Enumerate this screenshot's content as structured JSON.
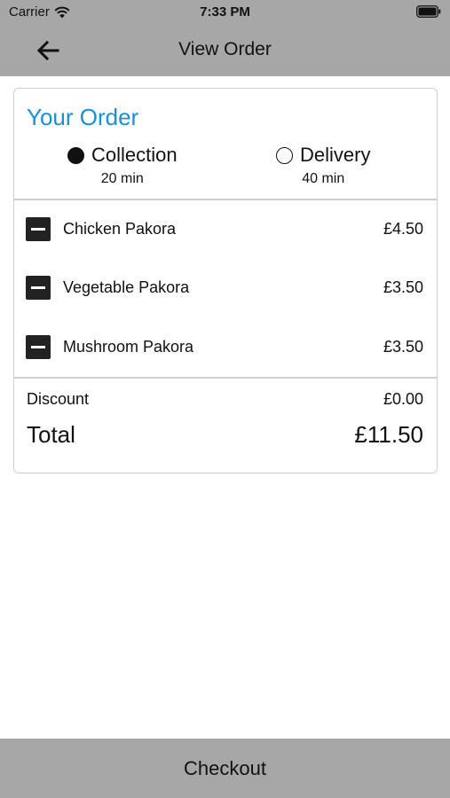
{
  "status_bar": {
    "carrier": "Carrier",
    "time": "7:33 PM",
    "icons": [
      "wifi-icon",
      "battery-icon"
    ]
  },
  "nav": {
    "back_icon": "arrow-left-icon",
    "title": "View Order"
  },
  "order": {
    "title": "Your Order",
    "title_color": "#1b8fd8",
    "options": [
      {
        "label": "Collection",
        "time": "20 min",
        "selected": true
      },
      {
        "label": "Delivery",
        "time": "40 min",
        "selected": false
      }
    ],
    "items": [
      {
        "name": "Chicken Pakora",
        "price": "£4.50",
        "remove_icon": "minus-icon"
      },
      {
        "name": "Vegetable Pakora",
        "price": "£3.50",
        "remove_icon": "minus-icon"
      },
      {
        "name": "Mushroom Pakora",
        "price": "£3.50",
        "remove_icon": "minus-icon"
      }
    ],
    "discount_label": "Discount",
    "discount_value": "£0.00",
    "total_label": "Total",
    "total_value": "£11.50"
  },
  "checkout": {
    "label": "Checkout"
  },
  "colors": {
    "header_bg": "#a7a7a7",
    "accent": "#1b8fd8"
  }
}
